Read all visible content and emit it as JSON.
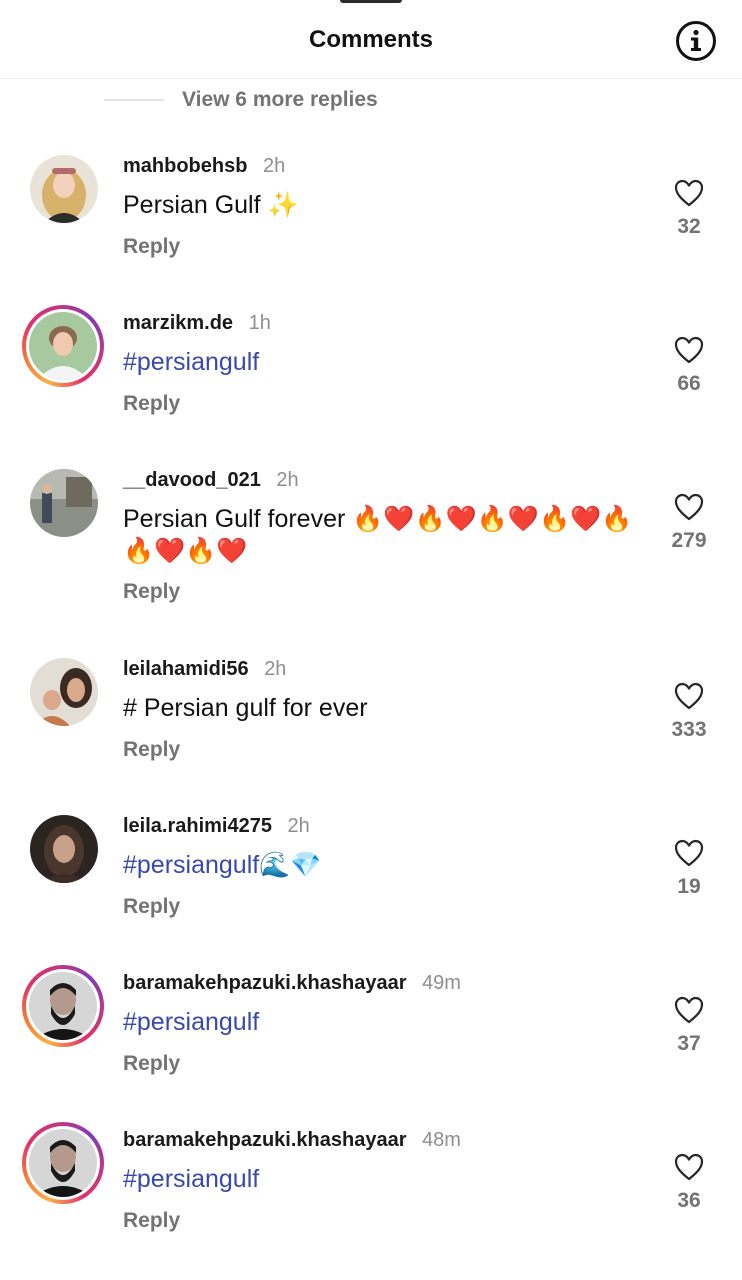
{
  "header": {
    "title": "Comments",
    "info_icon": "info-circle-icon"
  },
  "view_replies": "View 6 more replies",
  "comments": [
    {
      "username": "mahbobehsb",
      "time": "2h",
      "text": "Persian Gulf ✨",
      "reply": "Reply",
      "likes": "32",
      "avatar_ring": false,
      "hashtag": false
    },
    {
      "username": "marzikm.de",
      "time": "1h",
      "text": "#persiangulf",
      "reply": "Reply",
      "likes": "66",
      "avatar_ring": true,
      "hashtag": true
    },
    {
      "username": "__davood_021",
      "time": "2h",
      "text": "Persian Gulf forever 🔥❤️🔥❤️🔥❤️🔥❤️🔥🔥❤️🔥❤️",
      "reply": "Reply",
      "likes": "279",
      "avatar_ring": false,
      "hashtag": false
    },
    {
      "username": "leilahamidi56",
      "time": "2h",
      "text": "# Persian gulf for ever",
      "reply": "Reply",
      "likes": "333",
      "avatar_ring": false,
      "hashtag": false
    },
    {
      "username": "leila.rahimi4275",
      "time": "2h",
      "text": "#persiangulf🌊💎",
      "reply": "Reply",
      "likes": "19",
      "avatar_ring": false,
      "hashtag": true
    },
    {
      "username": "baramakehpazuki.khashayaar",
      "time": "49m",
      "text": "#persiangulf",
      "reply": "Reply",
      "likes": "37",
      "avatar_ring": true,
      "hashtag": true
    },
    {
      "username": "baramakehpazuki.khashayaar",
      "time": "48m",
      "text": "#persiangulf",
      "reply": "Reply",
      "likes": "36",
      "avatar_ring": true,
      "hashtag": true
    }
  ],
  "colors": {
    "hashtag": "#3949ab",
    "muted": "#737373",
    "ring_gradient": [
      "#fcaf45",
      "#e1306c",
      "#833ab4"
    ]
  }
}
